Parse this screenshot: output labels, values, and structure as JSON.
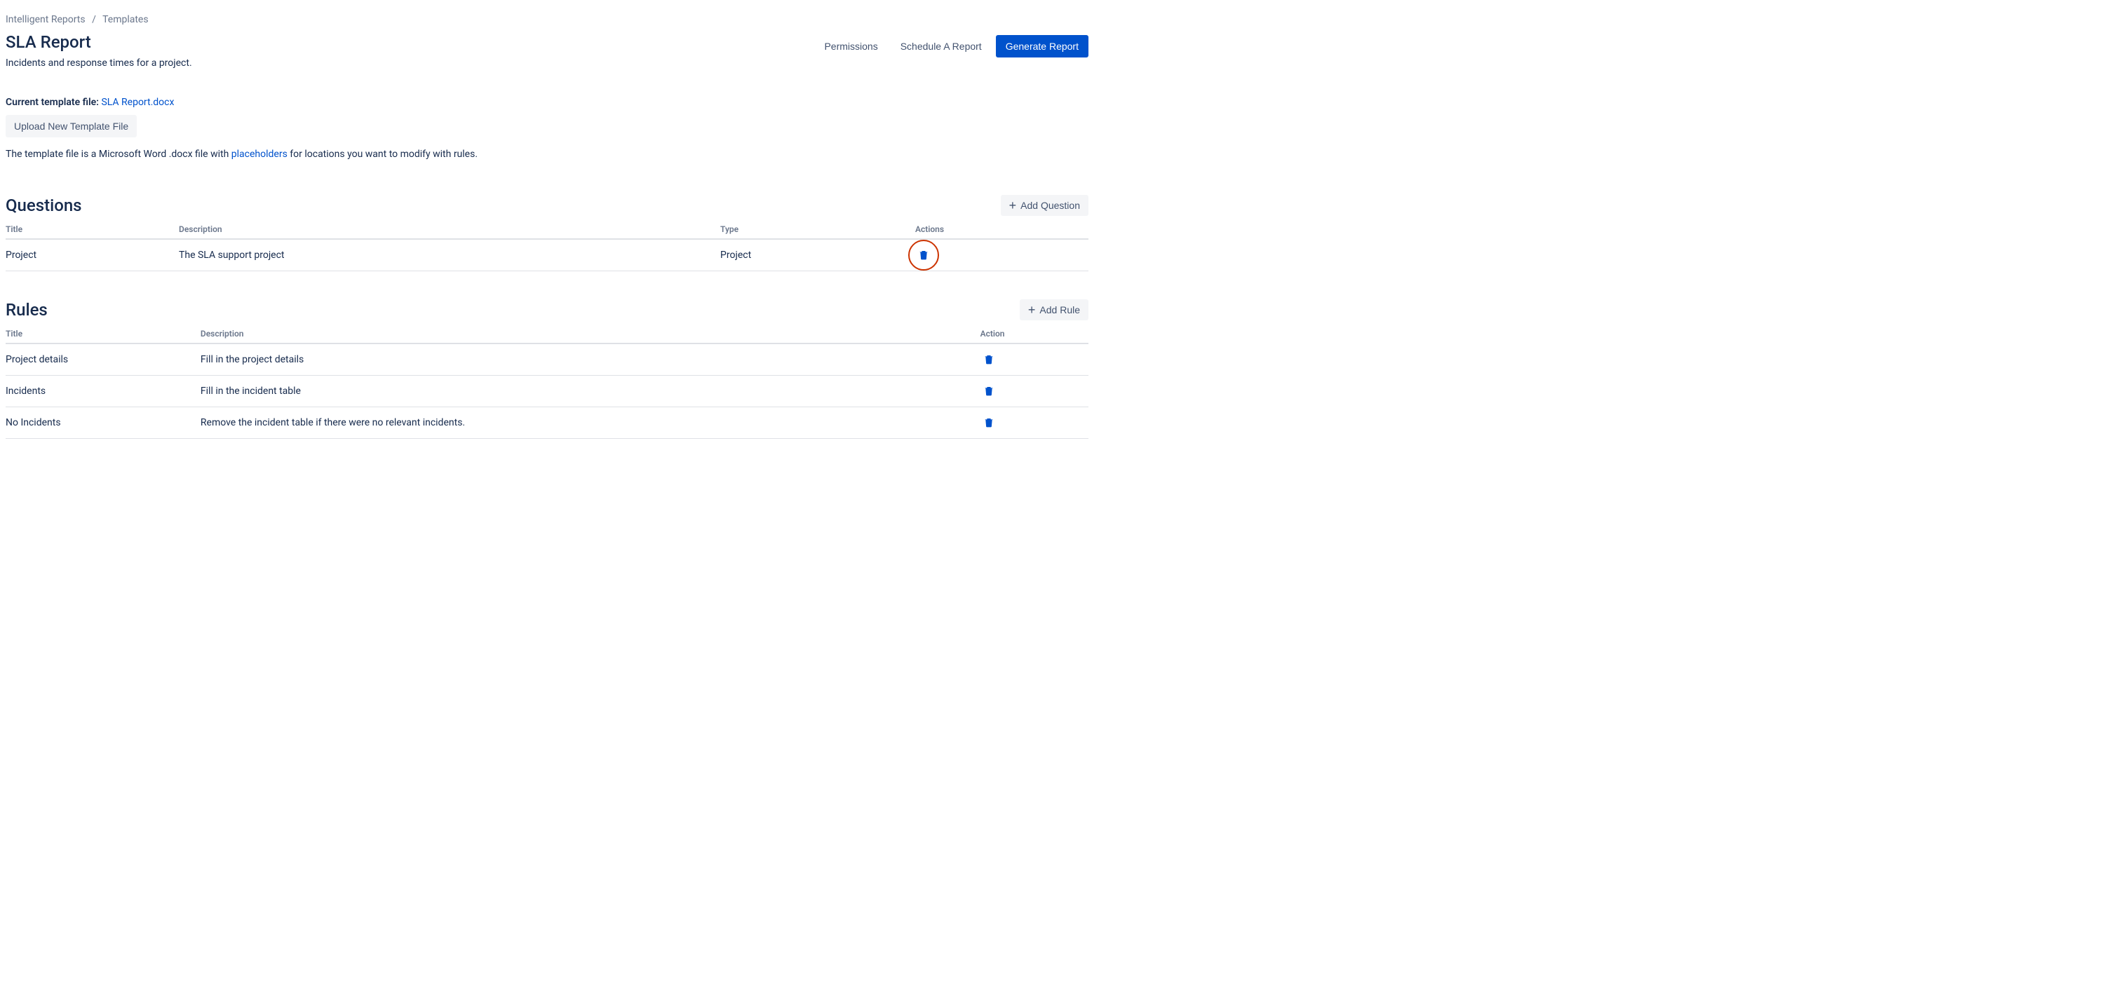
{
  "breadcrumb": {
    "item1": "Intelligent Reports",
    "item2": "Templates"
  },
  "header": {
    "title": "SLA Report",
    "description": "Incidents and response times for a project.",
    "permissions_label": "Permissions",
    "schedule_label": "Schedule A Report",
    "generate_label": "Generate Report"
  },
  "template_file": {
    "label": "Current template file:",
    "filename": "SLA Report.docx",
    "upload_button": "Upload New Template File",
    "hint_pre": "The template file is a Microsoft Word .docx file with ",
    "hint_link": "placeholders",
    "hint_post": " for locations you want to modify with rules."
  },
  "questions_section": {
    "title": "Questions",
    "add_button": "Add Question",
    "columns": {
      "title": "Title",
      "description": "Description",
      "type": "Type",
      "actions": "Actions"
    },
    "rows": [
      {
        "title": "Project",
        "description": "The SLA support project",
        "type": "Project"
      }
    ]
  },
  "rules_section": {
    "title": "Rules",
    "add_button": "Add Rule",
    "columns": {
      "title": "Title",
      "description": "Description",
      "action": "Action"
    },
    "rows": [
      {
        "title": "Project details",
        "description": "Fill in the project details"
      },
      {
        "title": "Incidents",
        "description": "Fill in the incident table"
      },
      {
        "title": "No Incidents",
        "description": "Remove the incident table if there were no relevant incidents."
      }
    ]
  }
}
